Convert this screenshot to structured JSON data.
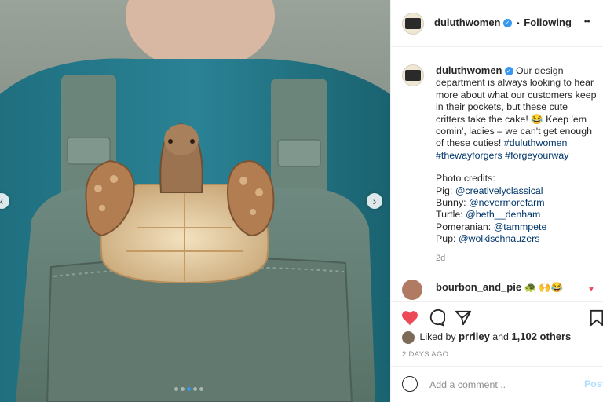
{
  "post": {
    "username": "duluthwomen",
    "follow_state": "Following",
    "separator": "•",
    "more": "•••",
    "caption_main": "Our design department is always looking to hear more about what our customers keep in their pockets, but these cute critters take the cake! 😂 Keep 'em comin', ladies – we can't get enough of these cuties!",
    "hashtags": [
      "#duluthwomen",
      "#thewayforgers",
      "#forgeyourway"
    ],
    "credits_title": "Photo credits:",
    "credits": [
      {
        "label": "Pig:",
        "handle": "@creativelyclassical"
      },
      {
        "label": "Bunny:",
        "handle": "@nevermorefarm"
      },
      {
        "label": "Turtle:",
        "handle": "@beth__denham"
      },
      {
        "label": "Pomeranian:",
        "handle": "@tammpete"
      },
      {
        "label": "Pup:",
        "handle": "@wolkischnauzers"
      }
    ],
    "age": "2d",
    "comment": {
      "username": "bourbon_and_pie",
      "text": "🐢 🙌😂"
    },
    "likes": {
      "prefix": "Liked by",
      "user": "prriley",
      "and": "and",
      "count": "1,102 others"
    },
    "date": "2 DAYS AGO",
    "comment_placeholder": "Add a comment...",
    "post_label": "Post"
  },
  "carousel": {
    "dots": 5,
    "active_index": 2,
    "prev": "‹",
    "next": "›"
  },
  "colors": {
    "accent": "#3897f0",
    "like": "#ed4956",
    "link": "#00376b",
    "muted": "#8e8e8e"
  }
}
